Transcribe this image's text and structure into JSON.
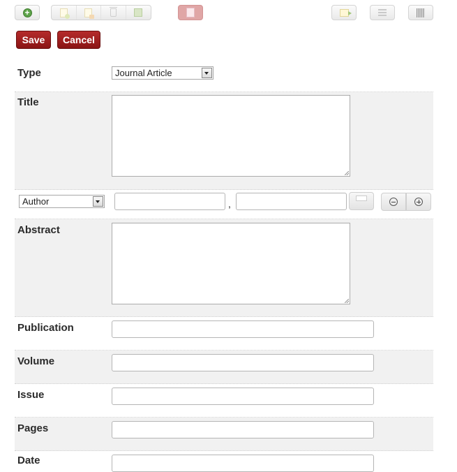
{
  "toolbar": {
    "new_item": "plus-circle-icon",
    "group1": [
      "new-document-icon",
      "classify-document-icon",
      "trash-icon",
      "restore-icon"
    ],
    "pdf": "pdf-document-icon",
    "export": "export-icon",
    "list": "list-view-icon",
    "columns": "columns-view-icon"
  },
  "actions": {
    "save_label": "Save",
    "cancel_label": "Cancel"
  },
  "form": {
    "type": {
      "label": "Type",
      "value": "Journal Article"
    },
    "title": {
      "label": "Title"
    },
    "creator": {
      "role": "Author",
      "comma": ","
    },
    "abstract": {
      "label": "Abstract"
    },
    "publication": {
      "label": "Publication"
    },
    "volume": {
      "label": "Volume"
    },
    "issue": {
      "label": "Issue"
    },
    "pages": {
      "label": "Pages"
    },
    "date": {
      "label": "Date"
    }
  },
  "colors": {
    "primary_button": "#9e1f1f",
    "alt_row": "#f1f1f1"
  }
}
